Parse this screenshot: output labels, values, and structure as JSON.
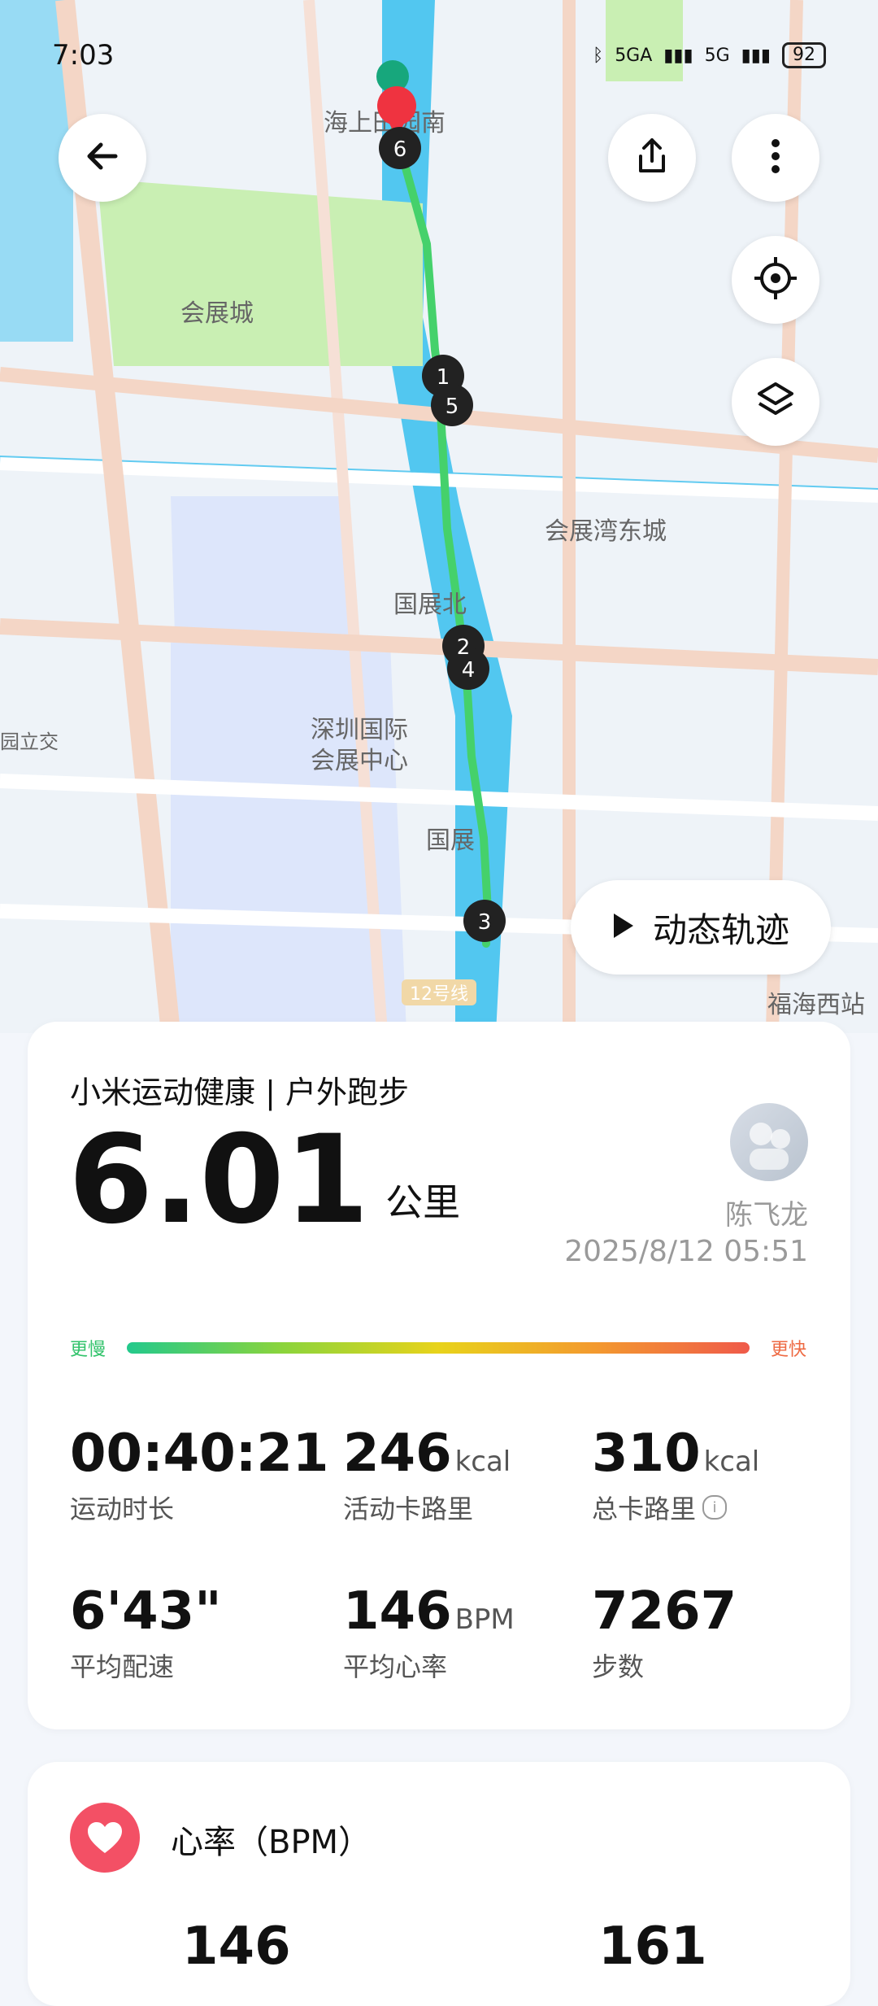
{
  "status_bar": {
    "time": "7:03",
    "network1": "5GA",
    "network2": "5G",
    "battery": "92"
  },
  "map": {
    "labels": {
      "top_area": "海上田园南",
      "expo_city": "会展城",
      "east_city": "会展湾东城",
      "north": "国展北",
      "center_line1": "深圳国际",
      "center_line2": "会展中心",
      "guozhan": "国展",
      "left_edge": "园立交",
      "route": "12号线",
      "fuhai": "福海西站"
    },
    "markers": [
      "1",
      "2",
      "3",
      "4",
      "5",
      "6"
    ],
    "dynamic_track_label": "动态轨迹"
  },
  "summary": {
    "title": "小米运动健康 | 户外跑步",
    "distance": "6.01",
    "distance_unit": "公里",
    "user_name": "陈飞龙",
    "date": "2025/8/12 05:51",
    "pace_slow": "更慢",
    "pace_fast": "更快",
    "metrics": [
      {
        "value": "00:40:21",
        "unit": "",
        "label": "运动时长"
      },
      {
        "value": "246",
        "unit": "kcal",
        "label": "活动卡路里"
      },
      {
        "value": "310",
        "unit": "kcal",
        "label": "总卡路里"
      },
      {
        "value": "6'43\"",
        "unit": "",
        "label": "平均配速"
      },
      {
        "value": "146",
        "unit": "BPM",
        "label": "平均心率"
      },
      {
        "value": "7267",
        "unit": "",
        "label": "步数"
      }
    ]
  },
  "heart_rate": {
    "title": "心率（BPM）",
    "values": [
      "146",
      "161"
    ]
  },
  "colors": {
    "route": "#45d16b",
    "accent_red": "#f35065",
    "map_water": "#52c7f0",
    "map_green": "#c9efb3"
  }
}
